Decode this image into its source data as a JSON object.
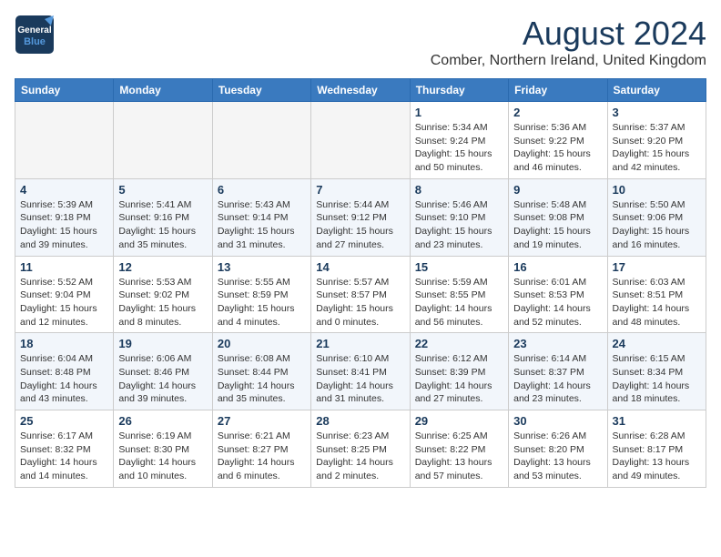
{
  "logo": {
    "line1": "General",
    "line2": "Blue"
  },
  "title": "August 2024",
  "subtitle": "Comber, Northern Ireland, United Kingdom",
  "days_of_week": [
    "Sunday",
    "Monday",
    "Tuesday",
    "Wednesday",
    "Thursday",
    "Friday",
    "Saturday"
  ],
  "weeks": [
    [
      {
        "day": "",
        "info": ""
      },
      {
        "day": "",
        "info": ""
      },
      {
        "day": "",
        "info": ""
      },
      {
        "day": "",
        "info": ""
      },
      {
        "day": "1",
        "info": "Sunrise: 5:34 AM\nSunset: 9:24 PM\nDaylight: 15 hours\nand 50 minutes."
      },
      {
        "day": "2",
        "info": "Sunrise: 5:36 AM\nSunset: 9:22 PM\nDaylight: 15 hours\nand 46 minutes."
      },
      {
        "day": "3",
        "info": "Sunrise: 5:37 AM\nSunset: 9:20 PM\nDaylight: 15 hours\nand 42 minutes."
      }
    ],
    [
      {
        "day": "4",
        "info": "Sunrise: 5:39 AM\nSunset: 9:18 PM\nDaylight: 15 hours\nand 39 minutes."
      },
      {
        "day": "5",
        "info": "Sunrise: 5:41 AM\nSunset: 9:16 PM\nDaylight: 15 hours\nand 35 minutes."
      },
      {
        "day": "6",
        "info": "Sunrise: 5:43 AM\nSunset: 9:14 PM\nDaylight: 15 hours\nand 31 minutes."
      },
      {
        "day": "7",
        "info": "Sunrise: 5:44 AM\nSunset: 9:12 PM\nDaylight: 15 hours\nand 27 minutes."
      },
      {
        "day": "8",
        "info": "Sunrise: 5:46 AM\nSunset: 9:10 PM\nDaylight: 15 hours\nand 23 minutes."
      },
      {
        "day": "9",
        "info": "Sunrise: 5:48 AM\nSunset: 9:08 PM\nDaylight: 15 hours\nand 19 minutes."
      },
      {
        "day": "10",
        "info": "Sunrise: 5:50 AM\nSunset: 9:06 PM\nDaylight: 15 hours\nand 16 minutes."
      }
    ],
    [
      {
        "day": "11",
        "info": "Sunrise: 5:52 AM\nSunset: 9:04 PM\nDaylight: 15 hours\nand 12 minutes."
      },
      {
        "day": "12",
        "info": "Sunrise: 5:53 AM\nSunset: 9:02 PM\nDaylight: 15 hours\nand 8 minutes."
      },
      {
        "day": "13",
        "info": "Sunrise: 5:55 AM\nSunset: 8:59 PM\nDaylight: 15 hours\nand 4 minutes."
      },
      {
        "day": "14",
        "info": "Sunrise: 5:57 AM\nSunset: 8:57 PM\nDaylight: 15 hours\nand 0 minutes."
      },
      {
        "day": "15",
        "info": "Sunrise: 5:59 AM\nSunset: 8:55 PM\nDaylight: 14 hours\nand 56 minutes."
      },
      {
        "day": "16",
        "info": "Sunrise: 6:01 AM\nSunset: 8:53 PM\nDaylight: 14 hours\nand 52 minutes."
      },
      {
        "day": "17",
        "info": "Sunrise: 6:03 AM\nSunset: 8:51 PM\nDaylight: 14 hours\nand 48 minutes."
      }
    ],
    [
      {
        "day": "18",
        "info": "Sunrise: 6:04 AM\nSunset: 8:48 PM\nDaylight: 14 hours\nand 43 minutes."
      },
      {
        "day": "19",
        "info": "Sunrise: 6:06 AM\nSunset: 8:46 PM\nDaylight: 14 hours\nand 39 minutes."
      },
      {
        "day": "20",
        "info": "Sunrise: 6:08 AM\nSunset: 8:44 PM\nDaylight: 14 hours\nand 35 minutes."
      },
      {
        "day": "21",
        "info": "Sunrise: 6:10 AM\nSunset: 8:41 PM\nDaylight: 14 hours\nand 31 minutes."
      },
      {
        "day": "22",
        "info": "Sunrise: 6:12 AM\nSunset: 8:39 PM\nDaylight: 14 hours\nand 27 minutes."
      },
      {
        "day": "23",
        "info": "Sunrise: 6:14 AM\nSunset: 8:37 PM\nDaylight: 14 hours\nand 23 minutes."
      },
      {
        "day": "24",
        "info": "Sunrise: 6:15 AM\nSunset: 8:34 PM\nDaylight: 14 hours\nand 18 minutes."
      }
    ],
    [
      {
        "day": "25",
        "info": "Sunrise: 6:17 AM\nSunset: 8:32 PM\nDaylight: 14 hours\nand 14 minutes."
      },
      {
        "day": "26",
        "info": "Sunrise: 6:19 AM\nSunset: 8:30 PM\nDaylight: 14 hours\nand 10 minutes."
      },
      {
        "day": "27",
        "info": "Sunrise: 6:21 AM\nSunset: 8:27 PM\nDaylight: 14 hours\nand 6 minutes."
      },
      {
        "day": "28",
        "info": "Sunrise: 6:23 AM\nSunset: 8:25 PM\nDaylight: 14 hours\nand 2 minutes."
      },
      {
        "day": "29",
        "info": "Sunrise: 6:25 AM\nSunset: 8:22 PM\nDaylight: 13 hours\nand 57 minutes."
      },
      {
        "day": "30",
        "info": "Sunrise: 6:26 AM\nSunset: 8:20 PM\nDaylight: 13 hours\nand 53 minutes."
      },
      {
        "day": "31",
        "info": "Sunrise: 6:28 AM\nSunset: 8:17 PM\nDaylight: 13 hours\nand 49 minutes."
      }
    ]
  ]
}
